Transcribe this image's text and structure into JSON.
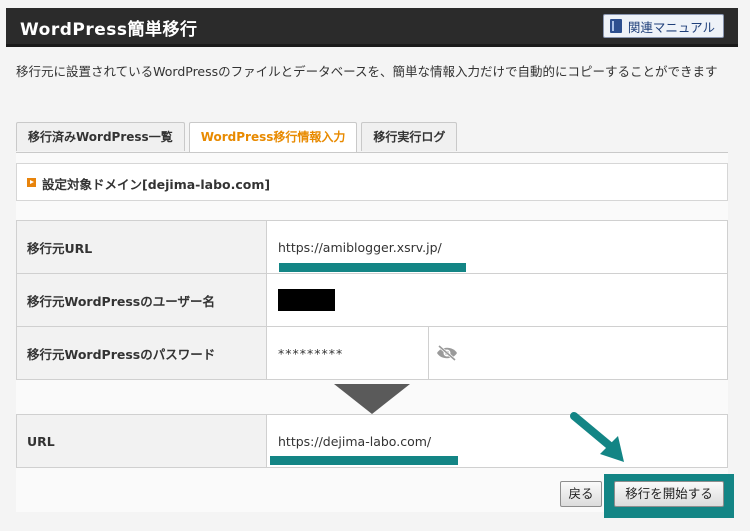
{
  "header": {
    "title": "WordPress簡単移行",
    "manual_label": "関連マニュアル"
  },
  "description": "移行元に設置されているWordPressのファイルとデータベースを、簡単な情報入力だけで自動的にコピーすることができます",
  "tabs": [
    {
      "label": "移行済みWordPress一覧",
      "active": false
    },
    {
      "label": "WordPress移行情報入力",
      "active": true
    },
    {
      "label": "移行実行ログ",
      "active": false
    }
  ],
  "target_domain": "設定対象ドメイン[dejima-labo.com]",
  "source": {
    "url_label": "移行元URL",
    "url_value": "https://amiblogger.xsrv.jp/",
    "user_label": "移行元WordPressのユーザー名",
    "password_label": "移行元WordPressのパスワード",
    "password_value": "*********"
  },
  "destination": {
    "url_label": "URL",
    "url_value": "https://dejima-labo.com/"
  },
  "buttons": {
    "back": "戻る",
    "start": "移行を開始する"
  },
  "colors": {
    "accent_tab": "#e88a00",
    "highlight": "#138585",
    "header_bg": "#2b2b2b"
  },
  "icons": {
    "manual": "book-icon",
    "password_toggle": "eye-slash-icon",
    "annotation": "arrow-pointer-icon"
  }
}
